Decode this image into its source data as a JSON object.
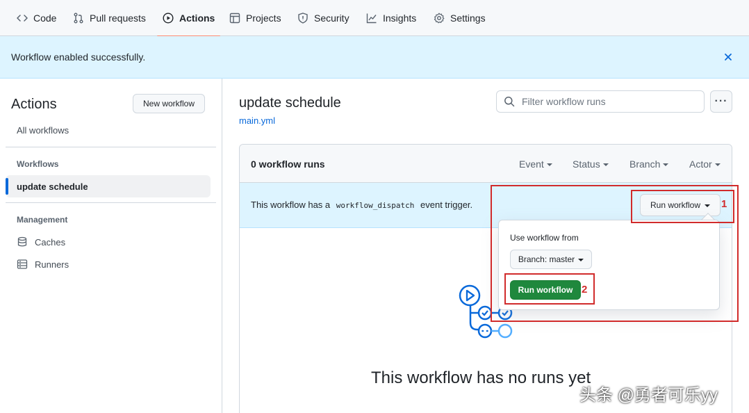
{
  "nav": {
    "items": [
      {
        "label": "Code",
        "icon": "code-icon"
      },
      {
        "label": "Pull requests",
        "icon": "pull-request-icon"
      },
      {
        "label": "Actions",
        "icon": "play-icon",
        "active": true
      },
      {
        "label": "Projects",
        "icon": "table-icon"
      },
      {
        "label": "Security",
        "icon": "shield-icon"
      },
      {
        "label": "Insights",
        "icon": "graph-icon"
      },
      {
        "label": "Settings",
        "icon": "gear-icon"
      }
    ]
  },
  "flash": {
    "message": "Workflow enabled successfully."
  },
  "sidebar": {
    "title": "Actions",
    "new_workflow_label": "New workflow",
    "all_workflows": "All workflows",
    "workflows_heading": "Workflows",
    "workflow_items": [
      "update schedule"
    ],
    "management_heading": "Management",
    "management_items": [
      {
        "label": "Caches",
        "icon": "database-icon"
      },
      {
        "label": "Runners",
        "icon": "server-icon"
      }
    ]
  },
  "main": {
    "title": "update schedule",
    "file": "main.yml",
    "search_placeholder": "Filter workflow runs",
    "more_label": "···"
  },
  "runs": {
    "count_label": "0 workflow runs",
    "filters": [
      "Event",
      "Status",
      "Branch",
      "Actor"
    ],
    "dispatch_prefix": "This workflow has a",
    "dispatch_code": "workflow_dispatch",
    "dispatch_suffix": "event trigger.",
    "run_workflow_label": "Run workflow",
    "empty_title": "This workflow has no runs yet"
  },
  "dropdown": {
    "use_from_label": "Use workflow from",
    "branch_label": "Branch: master",
    "run_button_label": "Run workflow"
  },
  "annotations": {
    "marker_1": "1",
    "marker_2": "2"
  },
  "watermark": "头条 @勇者可乐yy",
  "colors": {
    "accent": "#0969da",
    "success": "#1f883d",
    "active_tab_underline": "#fd8c73",
    "annotation_red": "#d12b2b",
    "flash_bg": "#ddf4ff"
  }
}
